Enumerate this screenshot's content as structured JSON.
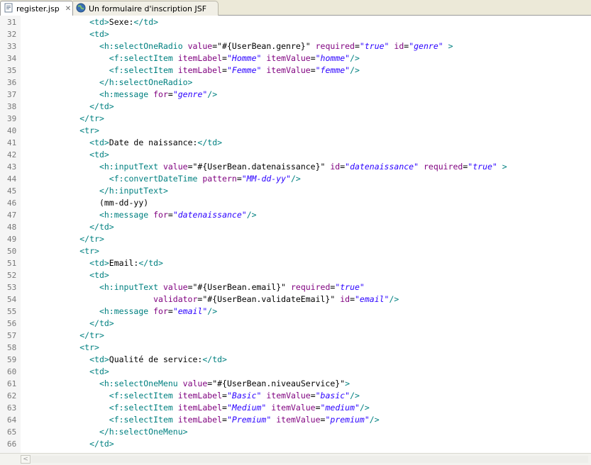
{
  "tabs": [
    {
      "label": "register.jsp",
      "icon": "jsp-file-icon",
      "close": "✕"
    },
    {
      "label": "Un formulaire d'inscription JSF",
      "icon": "globe-icon"
    }
  ],
  "lines": [
    {
      "n": "31",
      "segs": [
        [
          "t",
          "<td>"
        ],
        [
          "x",
          "Sexe:"
        ],
        [
          "t",
          "</td>"
        ]
      ],
      "indent": "            "
    },
    {
      "n": "32",
      "segs": [
        [
          "t",
          "<td>"
        ]
      ],
      "indent": "            "
    },
    {
      "n": "33",
      "segs": [
        [
          "t",
          "<h:selectOneRadio "
        ],
        [
          "a",
          "value"
        ],
        [
          "x",
          "=\"#{UserBean.genre}\" "
        ],
        [
          "a",
          "required"
        ],
        [
          "x",
          "="
        ],
        [
          "s",
          "\"true\""
        ],
        [
          "x",
          " "
        ],
        [
          "a",
          "id"
        ],
        [
          "x",
          "="
        ],
        [
          "s",
          "\"genre\""
        ],
        [
          "x",
          " "
        ],
        [
          "t",
          ">"
        ]
      ],
      "indent": "              "
    },
    {
      "n": "34",
      "segs": [
        [
          "t",
          "<f:selectItem "
        ],
        [
          "a",
          "itemLabel"
        ],
        [
          "x",
          "="
        ],
        [
          "s",
          "\"Homme\""
        ],
        [
          "x",
          " "
        ],
        [
          "a",
          "itemValue"
        ],
        [
          "x",
          "="
        ],
        [
          "s",
          "\"homme\""
        ],
        [
          "t",
          "/>"
        ]
      ],
      "indent": "                "
    },
    {
      "n": "35",
      "segs": [
        [
          "t",
          "<f:selectItem "
        ],
        [
          "a",
          "itemLabel"
        ],
        [
          "x",
          "="
        ],
        [
          "s",
          "\"Femme\""
        ],
        [
          "x",
          " "
        ],
        [
          "a",
          "itemValue"
        ],
        [
          "x",
          "="
        ],
        [
          "s",
          "\"femme\""
        ],
        [
          "t",
          "/>"
        ]
      ],
      "indent": "                "
    },
    {
      "n": "36",
      "segs": [
        [
          "t",
          "</h:selectOneRadio>"
        ]
      ],
      "indent": "              "
    },
    {
      "n": "37",
      "segs": [
        [
          "t",
          "<h:message "
        ],
        [
          "a",
          "for"
        ],
        [
          "x",
          "="
        ],
        [
          "s",
          "\"genre\""
        ],
        [
          "t",
          "/>"
        ]
      ],
      "indent": "              "
    },
    {
      "n": "38",
      "segs": [
        [
          "t",
          "</td>"
        ]
      ],
      "indent": "            "
    },
    {
      "n": "39",
      "segs": [
        [
          "t",
          "</tr>"
        ]
      ],
      "indent": "          "
    },
    {
      "n": "40",
      "segs": [
        [
          "t",
          "<tr>"
        ]
      ],
      "indent": "          "
    },
    {
      "n": "41",
      "segs": [
        [
          "t",
          "<td>"
        ],
        [
          "x",
          "Date de naissance:"
        ],
        [
          "t",
          "</td>"
        ]
      ],
      "indent": "            "
    },
    {
      "n": "42",
      "segs": [
        [
          "t",
          "<td>"
        ]
      ],
      "indent": "            "
    },
    {
      "n": "43",
      "segs": [
        [
          "t",
          "<h:inputText "
        ],
        [
          "a",
          "value"
        ],
        [
          "x",
          "=\"#{UserBean.datenaissance}\" "
        ],
        [
          "a",
          "id"
        ],
        [
          "x",
          "="
        ],
        [
          "s",
          "\"datenaissance\""
        ],
        [
          "x",
          " "
        ],
        [
          "a",
          "required"
        ],
        [
          "x",
          "="
        ],
        [
          "s",
          "\"true\""
        ],
        [
          "x",
          " "
        ],
        [
          "t",
          ">"
        ]
      ],
      "indent": "              "
    },
    {
      "n": "44",
      "segs": [
        [
          "t",
          "<f:convertDateTime "
        ],
        [
          "a",
          "pattern"
        ],
        [
          "x",
          "="
        ],
        [
          "s",
          "\"MM-dd-yy\""
        ],
        [
          "t",
          "/>"
        ]
      ],
      "indent": "                "
    },
    {
      "n": "45",
      "segs": [
        [
          "t",
          "</h:inputText>"
        ]
      ],
      "indent": "              "
    },
    {
      "n": "46",
      "segs": [
        [
          "x",
          "(mm-dd-yy)"
        ]
      ],
      "indent": "              "
    },
    {
      "n": "47",
      "segs": [
        [
          "t",
          "<h:message "
        ],
        [
          "a",
          "for"
        ],
        [
          "x",
          "="
        ],
        [
          "s",
          "\"datenaissance\""
        ],
        [
          "t",
          "/>"
        ]
      ],
      "indent": "              "
    },
    {
      "n": "48",
      "segs": [
        [
          "t",
          "</td>"
        ]
      ],
      "indent": "            "
    },
    {
      "n": "49",
      "segs": [
        [
          "t",
          "</tr>"
        ]
      ],
      "indent": "          "
    },
    {
      "n": "50",
      "segs": [
        [
          "t",
          "<tr>"
        ]
      ],
      "indent": "          "
    },
    {
      "n": "51",
      "segs": [
        [
          "t",
          "<td>"
        ],
        [
          "x",
          "Email:"
        ],
        [
          "t",
          "</td>"
        ]
      ],
      "indent": "            "
    },
    {
      "n": "52",
      "segs": [
        [
          "t",
          "<td>"
        ]
      ],
      "indent": "            "
    },
    {
      "n": "53",
      "segs": [
        [
          "t",
          "<h:inputText "
        ],
        [
          "a",
          "value"
        ],
        [
          "x",
          "=\"#{UserBean.email}\" "
        ],
        [
          "a",
          "required"
        ],
        [
          "x",
          "="
        ],
        [
          "s",
          "\"true\""
        ]
      ],
      "indent": "              "
    },
    {
      "n": "54",
      "segs": [
        [
          "a",
          "validator"
        ],
        [
          "x",
          "=\"#{UserBean.validateEmail}\" "
        ],
        [
          "a",
          "id"
        ],
        [
          "x",
          "="
        ],
        [
          "s",
          "\"email\""
        ],
        [
          "t",
          "/>"
        ]
      ],
      "indent": "                         "
    },
    {
      "n": "55",
      "segs": [
        [
          "t",
          "<h:message "
        ],
        [
          "a",
          "for"
        ],
        [
          "x",
          "="
        ],
        [
          "s",
          "\"email\""
        ],
        [
          "t",
          "/>"
        ]
      ],
      "indent": "              "
    },
    {
      "n": "56",
      "segs": [
        [
          "t",
          "</td>"
        ]
      ],
      "indent": "            "
    },
    {
      "n": "57",
      "segs": [
        [
          "t",
          "</tr>"
        ]
      ],
      "indent": "          "
    },
    {
      "n": "58",
      "segs": [
        [
          "t",
          "<tr>"
        ]
      ],
      "indent": "          "
    },
    {
      "n": "59",
      "segs": [
        [
          "t",
          "<td>"
        ],
        [
          "x",
          "Qualité de service:"
        ],
        [
          "t",
          "</td>"
        ]
      ],
      "indent": "            "
    },
    {
      "n": "60",
      "segs": [
        [
          "t",
          "<td>"
        ]
      ],
      "indent": "            "
    },
    {
      "n": "61",
      "segs": [
        [
          "t",
          "<h:selectOneMenu "
        ],
        [
          "a",
          "value"
        ],
        [
          "x",
          "=\"#{UserBean.niveauService}\""
        ],
        [
          "t",
          ">"
        ]
      ],
      "indent": "              "
    },
    {
      "n": "62",
      "segs": [
        [
          "t",
          "<f:selectItem "
        ],
        [
          "a",
          "itemLabel"
        ],
        [
          "x",
          "="
        ],
        [
          "s",
          "\"Basic\""
        ],
        [
          "x",
          " "
        ],
        [
          "a",
          "itemValue"
        ],
        [
          "x",
          "="
        ],
        [
          "s",
          "\"basic\""
        ],
        [
          "t",
          "/>"
        ]
      ],
      "indent": "                "
    },
    {
      "n": "63",
      "segs": [
        [
          "t",
          "<f:selectItem "
        ],
        [
          "a",
          "itemLabel"
        ],
        [
          "x",
          "="
        ],
        [
          "s",
          "\"Medium\""
        ],
        [
          "x",
          " "
        ],
        [
          "a",
          "itemValue"
        ],
        [
          "x",
          "="
        ],
        [
          "s",
          "\"medium\""
        ],
        [
          "t",
          "/>"
        ]
      ],
      "indent": "                "
    },
    {
      "n": "64",
      "segs": [
        [
          "t",
          "<f:selectItem "
        ],
        [
          "a",
          "itemLabel"
        ],
        [
          "x",
          "="
        ],
        [
          "s",
          "\"Premium\""
        ],
        [
          "x",
          " "
        ],
        [
          "a",
          "itemValue"
        ],
        [
          "x",
          "="
        ],
        [
          "s",
          "\"premium\""
        ],
        [
          "t",
          "/>"
        ]
      ],
      "indent": "                "
    },
    {
      "n": "65",
      "segs": [
        [
          "t",
          "</h:selectOneMenu>"
        ]
      ],
      "indent": "              "
    },
    {
      "n": "66",
      "segs": [
        [
          "t",
          "</td>"
        ]
      ],
      "indent": "            "
    }
  ],
  "scrollbar": {
    "left_arrow": "<"
  }
}
